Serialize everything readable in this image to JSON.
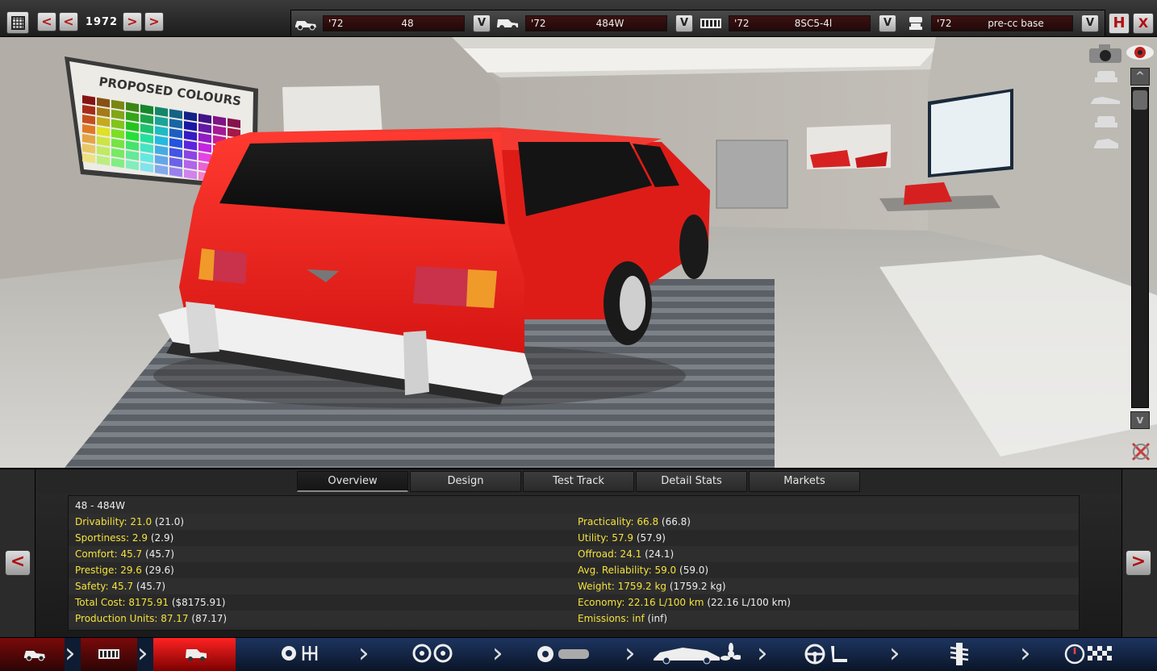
{
  "topbar": {
    "year": "1972",
    "prev_decade": "<",
    "prev_year": "<",
    "next_year": ">",
    "next_decade": ">",
    "slots": [
      {
        "icon": "chassis-icon",
        "year": "'72",
        "name": "48",
        "dropdown": "V"
      },
      {
        "icon": "car-body-icon",
        "year": "'72",
        "name": "484W",
        "dropdown": "V"
      },
      {
        "icon": "engine-block-icon",
        "year": "'72",
        "name": "8SC5-4l",
        "dropdown": "V"
      },
      {
        "icon": "piston-icon",
        "year": "'72",
        "name": "pre-cc base",
        "dropdown": "V"
      }
    ],
    "save": "H",
    "close": "X"
  },
  "scene": {
    "poster_title": "PROPOSED COLOURS",
    "car_color": "#e8211f"
  },
  "view_controls": {
    "scroll_up": "^",
    "scroll_down": "v"
  },
  "tabs": [
    "Overview",
    "Design",
    "Test Track",
    "Detail Stats",
    "Markets"
  ],
  "active_tab": "Overview",
  "overview": {
    "title": "48 - 484W",
    "left": [
      {
        "label": "Drivability: 21.0",
        "prev": "(21.0)"
      },
      {
        "label": "Sportiness: 2.9",
        "prev": "(2.9)"
      },
      {
        "label": "Comfort: 45.7",
        "prev": "(45.7)"
      },
      {
        "label": "Prestige: 29.6",
        "prev": "(29.6)"
      },
      {
        "label": "Safety: 45.7",
        "prev": "(45.7)"
      },
      {
        "label": "Total Cost: 8175.91",
        "prev": "($8175.91)"
      },
      {
        "label": "Production Units: 87.17",
        "prev": "(87.17)"
      }
    ],
    "right": [
      {
        "label": "Practicality: 66.8",
        "prev": "(66.8)"
      },
      {
        "label": "Utility: 57.9",
        "prev": "(57.9)"
      },
      {
        "label": "Offroad: 24.1",
        "prev": "(24.1)"
      },
      {
        "label": "Avg. Reliability: 59.0",
        "prev": "(59.0)"
      },
      {
        "label": "Weight: 1759.2 kg",
        "prev": "(1759.2 kg)"
      },
      {
        "label": "Economy: 22.16 L/100 km",
        "prev": "(22.16 L/100 km)"
      },
      {
        "label": "Emissions: inf",
        "prev": "(inf)"
      }
    ]
  },
  "panel_nav": {
    "prev": "<",
    "next": ">"
  },
  "bottom_nav": [
    {
      "name": "chassis",
      "icon": "chassis-icon",
      "active": false
    },
    {
      "name": "engine",
      "icon": "engine-block-icon",
      "active": false
    },
    {
      "name": "body",
      "icon": "car-body-icon",
      "active": true
    },
    {
      "name": "gearbox",
      "icon": "gear-icon",
      "active": false
    },
    {
      "name": "wheels",
      "icon": "wheel-icon",
      "active": false
    },
    {
      "name": "aero",
      "icon": "aero-car-icon",
      "active": false
    },
    {
      "name": "interior",
      "icon": "steering-wheel-icon",
      "active": false
    },
    {
      "name": "suspension",
      "icon": "shock-absorber-icon",
      "active": false
    },
    {
      "name": "testing",
      "icon": "gauge-checker-icon",
      "active": false
    }
  ]
}
